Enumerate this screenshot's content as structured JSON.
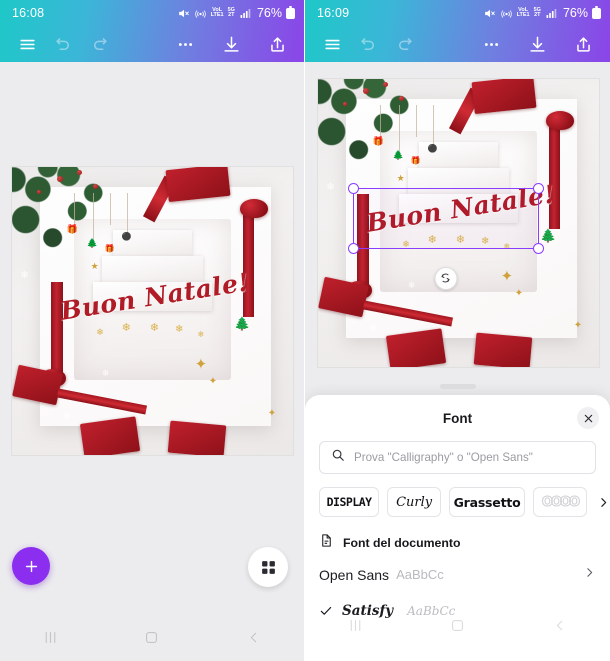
{
  "screens": [
    {
      "id": "left",
      "status": {
        "time": "16:08",
        "battery": "76%",
        "icons": [
          "mute-icon",
          "hotspot-icon",
          "volte-icon",
          "5g-icon",
          "signal-bars-icon",
          "battery-icon"
        ]
      },
      "toolbar": {
        "menu": "menu-icon",
        "undo": "undo-icon",
        "redo": "redo-icon",
        "more": "more-icon",
        "download": "download-icon",
        "share": "share-icon"
      },
      "design": {
        "greeting": "Buon Natale!"
      },
      "fab_label": "+",
      "grid_label": "grid-icon",
      "nav": [
        "recents-icon",
        "home-icon",
        "back-icon"
      ]
    },
    {
      "id": "right",
      "status": {
        "time": "16:09",
        "battery": "76%",
        "icons": [
          "mute-icon",
          "hotspot-icon",
          "volte-icon",
          "5g-icon",
          "signal-bars-icon",
          "battery-icon"
        ]
      },
      "toolbar": {
        "menu": "menu-icon",
        "undo": "undo-icon",
        "redo": "redo-icon",
        "more": "more-icon",
        "download": "download-icon",
        "share": "share-icon"
      },
      "design": {
        "greeting": "Buon Natale!"
      },
      "nav": [
        "recents-icon",
        "home-icon",
        "back-icon"
      ]
    }
  ],
  "font_sheet": {
    "title": "Font",
    "close_label": "×",
    "search": {
      "placeholder": "Prova \"Calligraphy\" o \"Open Sans\"",
      "value": "",
      "icon": "search-icon"
    },
    "chips": [
      {
        "label": "DISPLAY",
        "style": "display"
      },
      {
        "label": "Curly",
        "style": "curly"
      },
      {
        "label": "Grassetto",
        "style": "bold"
      },
      {
        "label": "OOOO",
        "style": "outline"
      }
    ],
    "chips_more": "›",
    "section": {
      "icon": "document-icon",
      "title": "Font del documento"
    },
    "fonts": [
      {
        "name": "Open Sans",
        "sample": "AaBbCc",
        "selected": false,
        "chevron": "›"
      },
      {
        "name": "Satisfy",
        "sample": "AaBbCc",
        "selected": true,
        "chevron": ""
      }
    ]
  },
  "colors": {
    "gradient_start": "#1ec8c8",
    "gradient_end": "#8b44e8",
    "accent_purple": "#8b2ef0",
    "selection_purple": "#8b3dff",
    "greeting_red": "#b01b26",
    "sheet_bg": "#ffffff",
    "app_bg": "#ececee"
  }
}
